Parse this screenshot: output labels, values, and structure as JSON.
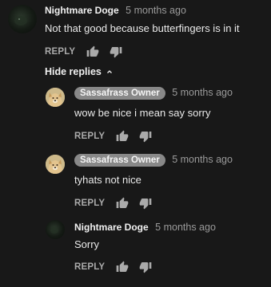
{
  "comments": [
    {
      "author": "Nightmare Doge",
      "time": "5 months ago",
      "text": "Not that good because butterfingers is in it",
      "avatar": "dark-dog-avatar",
      "reply_label": "REPLY"
    }
  ],
  "hide_replies_label": "Hide replies",
  "replies": [
    {
      "author": "Sassafrass Owner",
      "time": "5 months ago",
      "text": "wow be nice i mean say sorry",
      "avatar": "doge-avatar",
      "author_highlighted": true,
      "reply_label": "REPLY"
    },
    {
      "author": "Sassafrass Owner",
      "time": "5 months ago",
      "text": "tyhats not nice",
      "avatar": "doge-avatar",
      "author_highlighted": true,
      "reply_label": "REPLY"
    },
    {
      "author": "Nightmare Doge",
      "time": "5 months ago",
      "text": "Sorry",
      "avatar": "dark-dog-avatar",
      "author_highlighted": false,
      "reply_label": "REPLY"
    }
  ],
  "colors": {
    "background": "#181818",
    "author_chip": "#888888",
    "muted_text": "#aaaaaa"
  }
}
